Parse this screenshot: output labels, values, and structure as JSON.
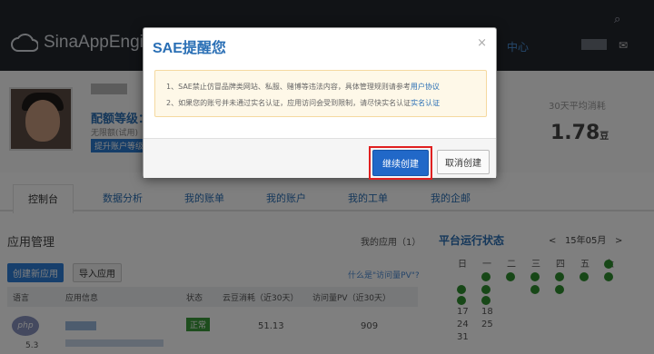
{
  "header": {
    "logo_text": "SinaAppEngine",
    "nav_item": "中心",
    "search_icon": "search-icon",
    "mail_icon": "mail-icon"
  },
  "profile": {
    "quota_label": "配额等级：",
    "quota_sub": "无限额(试用)",
    "upgrade_label": "提升账户等级",
    "avg_label": "30天平均消耗",
    "avg_value": "1.78",
    "avg_unit": "豆"
  },
  "tabs": [
    {
      "label": "控制台",
      "active": true
    },
    {
      "label": "数据分析"
    },
    {
      "label": "我的账单"
    },
    {
      "label": "我的账户"
    },
    {
      "label": "我的工单"
    },
    {
      "label": "我的企邮"
    }
  ],
  "app_management": {
    "title": "应用管理",
    "my_apps": "我的应用（1）",
    "create_label": "创建新应用",
    "import_label": "导入应用",
    "what_pv": "什么是\"访问量PV\"?",
    "columns": [
      "语言",
      "应用信息",
      "状态",
      "云豆消耗（近30天）",
      "访问量PV（近30天）"
    ],
    "rows": [
      {
        "lang": "php",
        "version": "5.3",
        "status": "正常",
        "beans": "51.13",
        "pv": "909"
      }
    ]
  },
  "platform": {
    "title": "平台运行状态",
    "month_label": "15年05月",
    "prev": "<",
    "next": ">",
    "weekdays": [
      "日",
      "一",
      "二",
      "三",
      "四",
      "五",
      "六"
    ],
    "row_numbers": [
      [
        "17",
        "18"
      ],
      [
        "24",
        "25"
      ],
      [
        "31"
      ]
    ]
  },
  "watermark": {
    "main": "Bai⊕经验",
    "sub": "jingyan.baidu.com"
  },
  "dialog": {
    "title": "SAE提醒您",
    "close_label": "×",
    "line1_text": "1、SAE禁止仿冒品牌类网站、私服、赌博等违法内容，具体管理规则请参考",
    "line1_link": "用户协议",
    "line2_text": "2、如果您的账号并未通过实名认证，应用访问会受到限制，请尽快实名认证",
    "line2_link": "实名认证",
    "continue_label": "继续创建",
    "cancel_label": "取消创建"
  },
  "colors": {
    "accent": "#2a6fb5",
    "primary_button": "#2168c8",
    "highlight_border": "#e02020",
    "status_ok": "#3a9a3a"
  }
}
